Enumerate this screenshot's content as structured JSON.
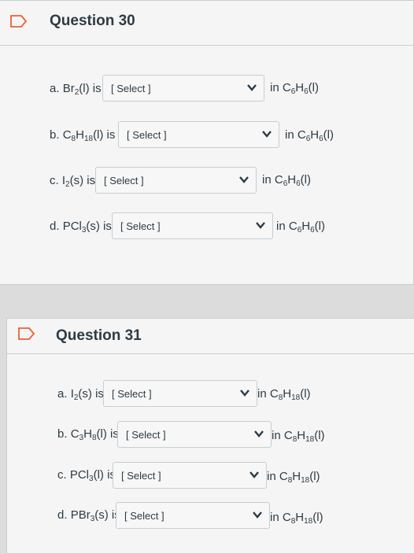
{
  "questions": [
    {
      "title": "Question 30",
      "items": [
        {
          "prefix": "a. ",
          "formula": [
            [
              "Br",
              ""
            ],
            [
              "2",
              "sub"
            ],
            [
              "(l) is",
              ""
            ]
          ],
          "select": "[ Select ]",
          "suffix": [
            [
              "in C",
              ""
            ],
            [
              "6",
              "sub"
            ],
            [
              "H",
              ""
            ],
            [
              "6",
              "sub"
            ],
            [
              "(l)",
              ""
            ]
          ]
        },
        {
          "prefix": "b. ",
          "formula": [
            [
              "C",
              ""
            ],
            [
              "8",
              "sub"
            ],
            [
              "H",
              ""
            ],
            [
              "18",
              "sub"
            ],
            [
              "(l) is",
              ""
            ]
          ],
          "select": "[ Select ]",
          "suffix": [
            [
              "in C",
              ""
            ],
            [
              "6",
              "sub"
            ],
            [
              "H",
              ""
            ],
            [
              "6",
              "sub"
            ],
            [
              "(l)",
              ""
            ]
          ]
        },
        {
          "prefix": "c. ",
          "formula": [
            [
              "I",
              ""
            ],
            [
              "2",
              "sub"
            ],
            [
              "(s) is",
              ""
            ]
          ],
          "select": "[ Select ]",
          "suffix": [
            [
              "in C",
              ""
            ],
            [
              "6",
              "sub"
            ],
            [
              "H",
              ""
            ],
            [
              "6",
              "sub"
            ],
            [
              "(l)",
              ""
            ]
          ]
        },
        {
          "prefix": "d. ",
          "formula": [
            [
              "PCl",
              ""
            ],
            [
              "3",
              "sub"
            ],
            [
              "(s) is",
              ""
            ]
          ],
          "select": "[ Select ]",
          "suffix": [
            [
              "in C",
              ""
            ],
            [
              "6",
              "sub"
            ],
            [
              "H",
              ""
            ],
            [
              "6",
              "sub"
            ],
            [
              "(l)",
              ""
            ]
          ]
        }
      ]
    },
    {
      "title": "Question 31",
      "items": [
        {
          "prefix": "a. ",
          "formula": [
            [
              "I",
              ""
            ],
            [
              "2",
              "sub"
            ],
            [
              "(s) is",
              ""
            ]
          ],
          "select": "[ Select ]",
          "suffix": [
            [
              "in C",
              ""
            ],
            [
              "8",
              "sub"
            ],
            [
              "H",
              ""
            ],
            [
              "18",
              "sub"
            ],
            [
              "(l)",
              ""
            ]
          ]
        },
        {
          "prefix": "b. ",
          "formula": [
            [
              "C",
              ""
            ],
            [
              "3",
              "sub"
            ],
            [
              "H",
              ""
            ],
            [
              "8",
              "sub"
            ],
            [
              "(l) is",
              ""
            ]
          ],
          "select": "[ Select ]",
          "suffix": [
            [
              "in C",
              ""
            ],
            [
              "8",
              "sub"
            ],
            [
              "H",
              ""
            ],
            [
              "18",
              "sub"
            ],
            [
              "(l)",
              ""
            ]
          ]
        },
        {
          "prefix": "c. ",
          "formula": [
            [
              "PCl",
              ""
            ],
            [
              "3",
              "sub"
            ],
            [
              "(l) is",
              ""
            ]
          ],
          "select": "[ Select ]",
          "suffix": [
            [
              "in C",
              ""
            ],
            [
              "8",
              "sub"
            ],
            [
              "H",
              ""
            ],
            [
              "18",
              "sub"
            ],
            [
              "(l)",
              ""
            ]
          ]
        },
        {
          "prefix": "d. ",
          "formula": [
            [
              "PBr",
              ""
            ],
            [
              "3",
              "sub"
            ],
            [
              "(s) is",
              ""
            ]
          ],
          "select": "[ Select ]",
          "suffix": [
            [
              "in C",
              ""
            ],
            [
              "8",
              "sub"
            ],
            [
              "H",
              ""
            ],
            [
              "18",
              "sub"
            ],
            [
              "(l)",
              ""
            ]
          ]
        }
      ]
    }
  ],
  "icons": {
    "flag": "flag-bookmark-icon",
    "chevron": "chevron-down-icon"
  },
  "colors": {
    "flag_stroke": "#e66135",
    "text": "#2d3b45",
    "border": "#c7cdd1"
  }
}
